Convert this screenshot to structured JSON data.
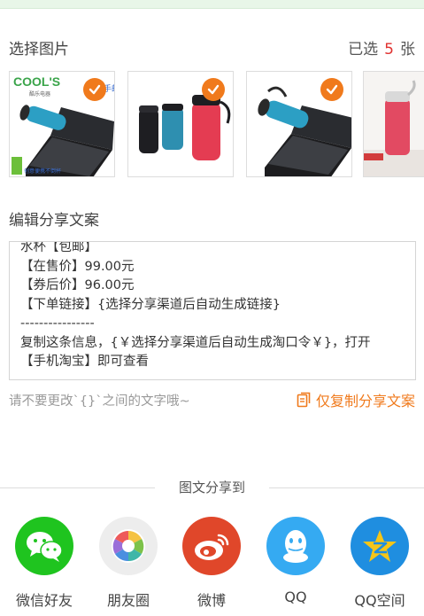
{
  "images_section": {
    "title": "选择图片",
    "selected_prefix": "已选",
    "selected_count": "5",
    "selected_suffix": "张"
  },
  "thumbnails": [
    {
      "name": "cools-cup-laptop",
      "selected": true,
      "brand_text": "COOL'S",
      "brand_sub": "酷乐电器",
      "side_text": "手邮",
      "bottom_text": "创意便携不倒杯"
    },
    {
      "name": "three-cups",
      "selected": true
    },
    {
      "name": "blue-cup-laptop",
      "selected": true
    },
    {
      "name": "red-cup-book",
      "selected": false
    }
  ],
  "edit_section": {
    "title": "编辑分享文案"
  },
  "copy_text": {
    "line0": "水杯【包邮】",
    "line1": "【在售价】99.00元",
    "line2": "【券后价】96.00元",
    "line3": "【下单链接】{选择分享渠道后自动生成链接}",
    "line4": "----------------",
    "line5": "复制这条信息，{￥选择分享渠道后自动生成淘口令￥}，打开",
    "line6": "【手机淘宝】即可查看"
  },
  "hint": "请不要更改`{}`之间的文字哦~",
  "copy_button": "仅复制分享文案",
  "share_label": "图文分享到",
  "share_targets": [
    {
      "label": "微信好友",
      "icon": "wechat-icon",
      "color": "#1fc41f"
    },
    {
      "label": "朋友圈",
      "icon": "moments-icon",
      "color": "#ededed"
    },
    {
      "label": "微博",
      "icon": "weibo-icon",
      "color": "#e0472a"
    },
    {
      "label": "QQ",
      "icon": "qq-icon",
      "color": "#35aaf2"
    },
    {
      "label": "QQ空间",
      "icon": "qzone-icon",
      "color": "#1f8ee0"
    }
  ],
  "colors": {
    "accent": "#f07a1c",
    "count_red": "#e0312f"
  }
}
